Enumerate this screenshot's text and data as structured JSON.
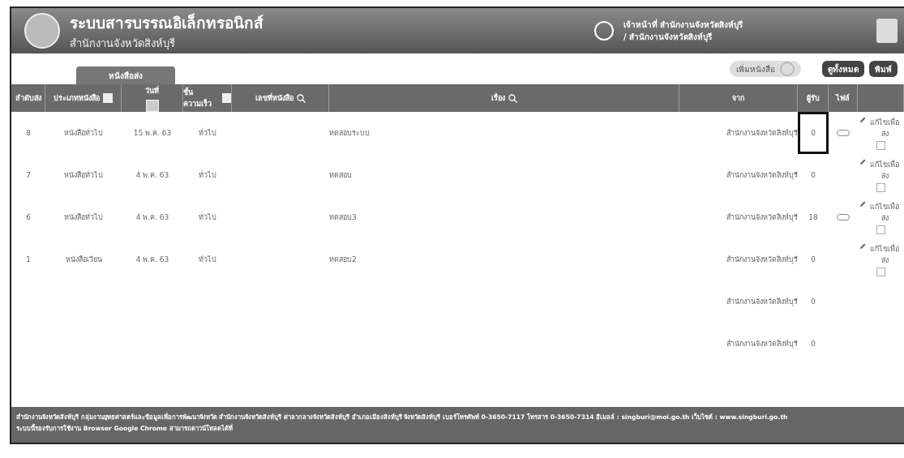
{
  "header": {
    "title": "ระบบสารบรรณอิเล็กทรอนิกส์",
    "subtitle": "สำนักงานจังหวัดสิงห์บุรี",
    "user_line_1": "เจ้าหน้าที่ สำนักงานจังหวัดสิงห์บุรี",
    "user_line_2": "/ สำนักงานจังหวัดสิงห์บุรี"
  },
  "tabs": [
    {
      "label": "หนังสือส่ง",
      "selected": true
    }
  ],
  "toolbar": {
    "add_button": "เพิ่มหนังสือ",
    "add_disabled": true,
    "buttons": [
      "ดูทั้งหมด",
      "พิมพ์"
    ]
  },
  "table": {
    "columns": [
      {
        "label": "ลำดับส่ง",
        "kind": "plain"
      },
      {
        "label": "ประเภทหนังสือ",
        "kind": "dropdown"
      },
      {
        "label": "วันที่",
        "kind": "calendar"
      },
      {
        "label": "ชั้นความเร็ว",
        "kind": "dropdown"
      },
      {
        "label": "เลขที่หนังสือ",
        "kind": "search"
      },
      {
        "label": "เรื่อง",
        "kind": "search"
      },
      {
        "label": "จาก",
        "kind": "plain"
      },
      {
        "label": "ผู้รับ",
        "kind": "plain"
      },
      {
        "label": "ไฟล์",
        "kind": "plain"
      }
    ],
    "rows": [
      {
        "order": "8",
        "type": "หนังสือทั่วไป",
        "date": "15 พ.ค. 63",
        "speed": "ทั่วไป",
        "subject": "ทดสอบระบบ",
        "from": "สำนักงานจังหวัดสิงห์บุรี",
        "receivers": "0",
        "highlighted": true,
        "has_file": true,
        "edit": "แก้ไขเพื่อส่ง"
      },
      {
        "order": "7",
        "type": "หนังสือทั่วไป",
        "date": "4 พ.ค. 63",
        "speed": "ทั่วไป",
        "subject": "ทดสอบ",
        "from": "สำนักงานจังหวัดสิงห์บุรี",
        "receivers": "0",
        "highlighted": false,
        "has_file": false,
        "edit": "แก้ไขเพื่อส่ง"
      },
      {
        "order": "6",
        "type": "หนังสือทั่วไป",
        "date": "4 พ.ค. 63",
        "speed": "ทั่วไป",
        "subject": "ทดสอบ3",
        "from": "สำนักงานจังหวัดสิงห์บุรี",
        "receivers": "18",
        "highlighted": false,
        "has_file": true,
        "edit": "แก้ไขเพื่อส่ง"
      },
      {
        "order": "1",
        "type": "หนังสือเวียน",
        "date": "4 พ.ค. 63",
        "speed": "ทั่วไป",
        "subject": "ทดสอบ2",
        "from": "สำนักงานจังหวัดสิงห์บุรี",
        "receivers": "0",
        "highlighted": false,
        "has_file": false,
        "edit": "แก้ไขเพื่อส่ง"
      },
      {
        "from": "สำนักงานจังหวัดสิงห์บุรี",
        "receivers": "0",
        "highlighted": false,
        "has_file": false
      },
      {
        "from": "สำนักงานจังหวัดสิงห์บุรี",
        "receivers": "0",
        "highlighted": false,
        "has_file": false
      }
    ]
  },
  "footer": {
    "line_1": "สำนักงานจังหวัดสิงห์บุรี กลุ่มงานยุทธศาสตร์และข้อมูลเพื่อการพัฒนาจังหวัด สำนักงานจังหวัดสิงห์บุรี ศาลากลางจังหวัดสิงห์บุรี อำเภอเมืองสิงห์บุรี จังหวัดสิงห์บุรี เบอร์โทรศัพท์ 0-3650-7117 โทรสาร 0-3650-7314 อีเมลล์ : singburi@moi.go.th เว็บไซต์ : www.singburi.go.th",
    "line_2": "ระบบนี้รองรับการใช้งาน Browser Google Chrome สามารถดาวน์โหลดได้ที่"
  }
}
